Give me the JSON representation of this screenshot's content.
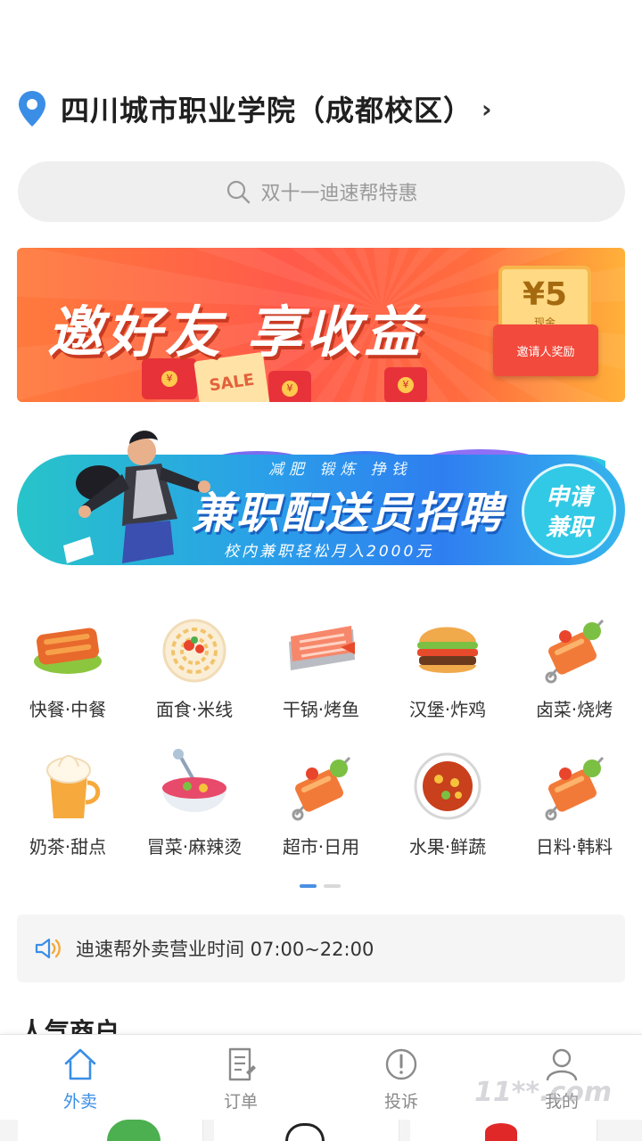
{
  "location": {
    "name": "四川城市职业学院（成都校区）",
    "chevron": "›"
  },
  "search": {
    "placeholder": "双十一迪速帮特惠"
  },
  "banner_invite": {
    "slogan": "邀好友 享收益",
    "coupon_amount": "¥5",
    "coupon_unit": "现金",
    "reward_label": "邀请人奖励",
    "sale_text": "SALE"
  },
  "banner_recruit": {
    "tagline": "减肥 锻炼 挣钱",
    "title": "兼职配送员招聘",
    "subtitle": "校内兼职轻松月入2000元",
    "badge_line1": "申请",
    "badge_line2": "兼职"
  },
  "categories": [
    {
      "label": "快餐·中餐",
      "icon": "fast-food-icon"
    },
    {
      "label": "面食·米线",
      "icon": "noodles-icon"
    },
    {
      "label": "干锅·烤鱼",
      "icon": "grilled-fish-icon"
    },
    {
      "label": "汉堡·炸鸡",
      "icon": "burger-icon"
    },
    {
      "label": "卤菜·烧烤",
      "icon": "skewer-icon"
    },
    {
      "label": "奶茶·甜点",
      "icon": "milk-tea-icon"
    },
    {
      "label": "冒菜·麻辣烫",
      "icon": "spicy-bowl-icon"
    },
    {
      "label": "超市·日用",
      "icon": "skewer-icon"
    },
    {
      "label": "水果·鲜蔬",
      "icon": "fruit-bowl-icon"
    },
    {
      "label": "日料·韩料",
      "icon": "skewer-icon"
    }
  ],
  "pager": {
    "pages": 2,
    "current": 1
  },
  "notice": {
    "text": "迪速帮外卖营业时间  07:00~22:00",
    "icon": "speaker-icon"
  },
  "section_title": "人气商户",
  "tabs": [
    {
      "label": "外卖",
      "icon": "home-icon",
      "active": true
    },
    {
      "label": "订单",
      "icon": "order-icon",
      "active": false
    },
    {
      "label": "投诉",
      "icon": "complaint-icon",
      "active": false
    },
    {
      "label": "我的",
      "icon": "user-icon",
      "active": false
    }
  ],
  "watermark": "11**.com",
  "colors": {
    "accent": "#3a8ee6",
    "banner_orange": "#ff5a4a",
    "banner_blue": "#2a8ee8"
  }
}
